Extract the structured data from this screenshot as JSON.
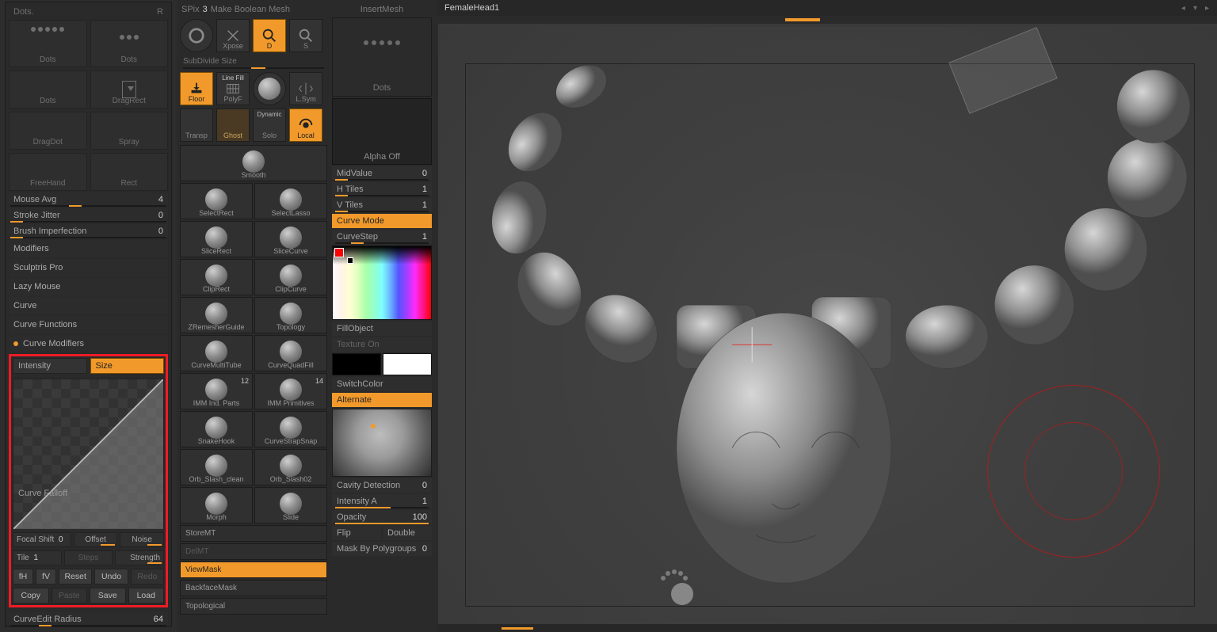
{
  "colors": {
    "accent": "#f19a2b",
    "highlight": "#ee1c25"
  },
  "left": {
    "title": "Dots.",
    "title_short": "R",
    "brushes": [
      {
        "name": "Dots"
      },
      {
        "name": "Dots"
      },
      {
        "name": "Dots"
      },
      {
        "name": "DragRect"
      },
      {
        "name": "DragDot"
      },
      {
        "name": "Spray"
      },
      {
        "name": "FreeHand"
      },
      {
        "name": "Rect"
      }
    ],
    "mouse_avg": {
      "label": "Mouse Avg",
      "value": "4"
    },
    "stroke_jitter": {
      "label": "Stroke Jitter",
      "value": "0"
    },
    "brush_imperfection": {
      "label": "Brush Imperfection",
      "value": "0"
    },
    "sections": {
      "modifiers": "Modifiers",
      "sculptris": "Sculptris Pro",
      "lazy": "Lazy Mouse",
      "curve": "Curve",
      "curve_functions": "Curve Functions",
      "curve_modifiers": "Curve Modifiers"
    },
    "curve_mod": {
      "intensity": "Intensity",
      "size": "Size",
      "falloff_label": "Curve Falloff",
      "focal": {
        "label": "Focal Shift",
        "value": "0"
      },
      "offset": "Offset",
      "noise": "Noise",
      "tile": {
        "label": "Tile",
        "value": "1"
      },
      "steps": "Steps",
      "strength": "Strength",
      "fH": "fH",
      "fV": "fV",
      "reset": "Reset",
      "undo": "Undo",
      "redo": "Redo",
      "copy": "Copy",
      "paste": "Paste",
      "save": "Save",
      "load": "Load"
    },
    "curveedit": {
      "label": "CurveEdit Radius",
      "value": "64"
    }
  },
  "mid": {
    "spix": {
      "label": "SPix",
      "value": "3"
    },
    "boolean_label": "Make Boolean Mesh",
    "insertmesh": "InsertMesh",
    "icons1": [
      {
        "name": "tool-icon",
        "label": ""
      },
      {
        "name": "xpose-icon",
        "label": "Xpose"
      },
      {
        "name": "d-mode-icon",
        "label": "D",
        "orange": true
      },
      {
        "name": "s-mode-icon",
        "label": "S"
      }
    ],
    "subdivide_label": "SubDivide Size",
    "icons2": [
      {
        "name": "floor-icon",
        "label": "Floor",
        "orange": true
      },
      {
        "name": "polyf-icon",
        "label": "PolyF",
        "header": "Line Fill"
      },
      {
        "name": "shade-icon",
        "label": ""
      },
      {
        "name": "lsym-icon",
        "label": "L.Sym"
      }
    ],
    "icons3": [
      {
        "name": "transp-icon",
        "label": "Transp"
      },
      {
        "name": "ghost-icon",
        "label": "Ghost"
      },
      {
        "name": "solo-icon",
        "label": "Solo",
        "header": "Dynamic"
      },
      {
        "name": "local-icon",
        "label": "Local",
        "orange": true
      }
    ],
    "smooth": "Smooth",
    "tools": [
      "SelectRect",
      "SelectLasso",
      "SliceRect",
      "SliceCurve",
      "ClipRect",
      "ClipCurve",
      "ZRemesherGuide",
      "Topology",
      "CurveMultiTube",
      "CurveQuadFill",
      "IMM Ind. Parts",
      "IMM Primitives",
      "SnakeHook",
      "CurveStrapSnap",
      "Orb_Slash_clean",
      "Orb_Slash02",
      "Morph",
      "Slide"
    ],
    "tool_badges": {
      "10": "12",
      "11": "14"
    },
    "storemt": "StoreMT",
    "delmt": "DelMT",
    "viewmask": "ViewMask",
    "backfacemask": "BackfaceMask",
    "topological": "Topological"
  },
  "midb": {
    "dots": "Dots",
    "alpha_off": "Alpha Off",
    "midvalue": {
      "label": "MidValue",
      "value": "0"
    },
    "htiles": {
      "label": "H Tiles",
      "value": "1"
    },
    "vtiles": {
      "label": "V Tiles",
      "value": "1"
    },
    "curve_mode": "Curve Mode",
    "curvestep": {
      "label": "CurveStep",
      "value": "1"
    },
    "fillobject": "FillObject",
    "textureon": "Texture On",
    "switchcolor": "SwitchColor",
    "alternate": "Alternate",
    "cavity": {
      "label": "Cavity Detection",
      "value": "0"
    },
    "intensityA": {
      "label": "Intensity A",
      "value": "1"
    },
    "opacity": {
      "label": "Opacity",
      "value": "100"
    },
    "flip": "Flip",
    "double": "Double",
    "mask_polygroups": {
      "label": "Mask By Polygroups",
      "value": "0"
    }
  },
  "viewport": {
    "title": "FemaleHead1"
  }
}
